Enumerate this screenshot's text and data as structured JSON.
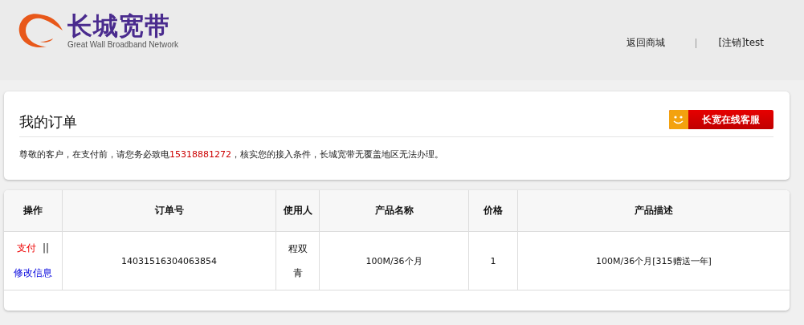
{
  "header": {
    "logo": {
      "name": "长城宽带",
      "tagline": "Great Wall Broadband Network"
    },
    "nav": [
      {
        "label": "返回商城"
      },
      {
        "label": "[注销]test"
      }
    ]
  },
  "orders_panel": {
    "title": "我的订单",
    "service_button": "长宽在线客服",
    "notice": {
      "before": "尊敬的客户，在支付前，请您务必致电",
      "phone": "15318881272",
      "after": "，核实您的接入条件，长城宽带无覆盖地区无法办理。"
    }
  },
  "table": {
    "columns": [
      "操作",
      "订单号",
      "使用人",
      "产品名称",
      "价格",
      "产品描述"
    ],
    "rows": [
      {
        "cells": [
          {
            "kind": "actions",
            "actions": [
              {
                "kind": "pay",
                "label": "支付"
              },
              {
                "kind": "separator",
                "label": "||"
              },
              {
                "kind": "edit",
                "label": "修改信息"
              }
            ]
          },
          {
            "kind": "text",
            "text": "14031516304063854"
          },
          {
            "kind": "text",
            "text": "程双青"
          },
          {
            "kind": "text",
            "text": "100M/36个月"
          },
          {
            "kind": "text",
            "text": "1"
          },
          {
            "kind": "text",
            "text": "100M/36个月[315赠送一年]"
          }
        ]
      }
    ]
  }
}
